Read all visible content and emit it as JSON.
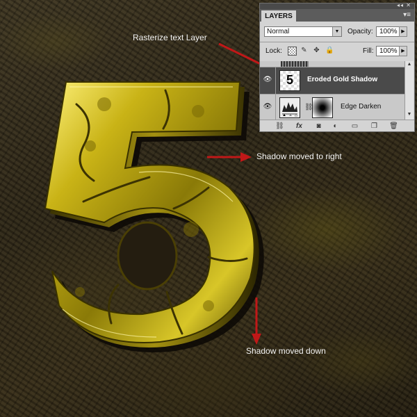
{
  "annotations": {
    "rasterize": "Rasterize text Layer",
    "shadow_right": "Shadow moved to right",
    "shadow_down": "Shadow moved down"
  },
  "artwork": {
    "glyph": "5",
    "gold_color": "#c9b316",
    "arrow_color": "#c01818"
  },
  "layers_panel": {
    "title": "LAYERS",
    "blend_mode": "Normal",
    "opacity_label": "Opacity:",
    "opacity_value": "100%",
    "lock_label": "Lock:",
    "fill_label": "Fill:",
    "fill_value": "100%",
    "layers": [
      {
        "name": "Eroded Gold Shadow",
        "thumb_text": "5",
        "selected": true
      },
      {
        "name": "Edge Darken",
        "selected": false
      }
    ]
  }
}
